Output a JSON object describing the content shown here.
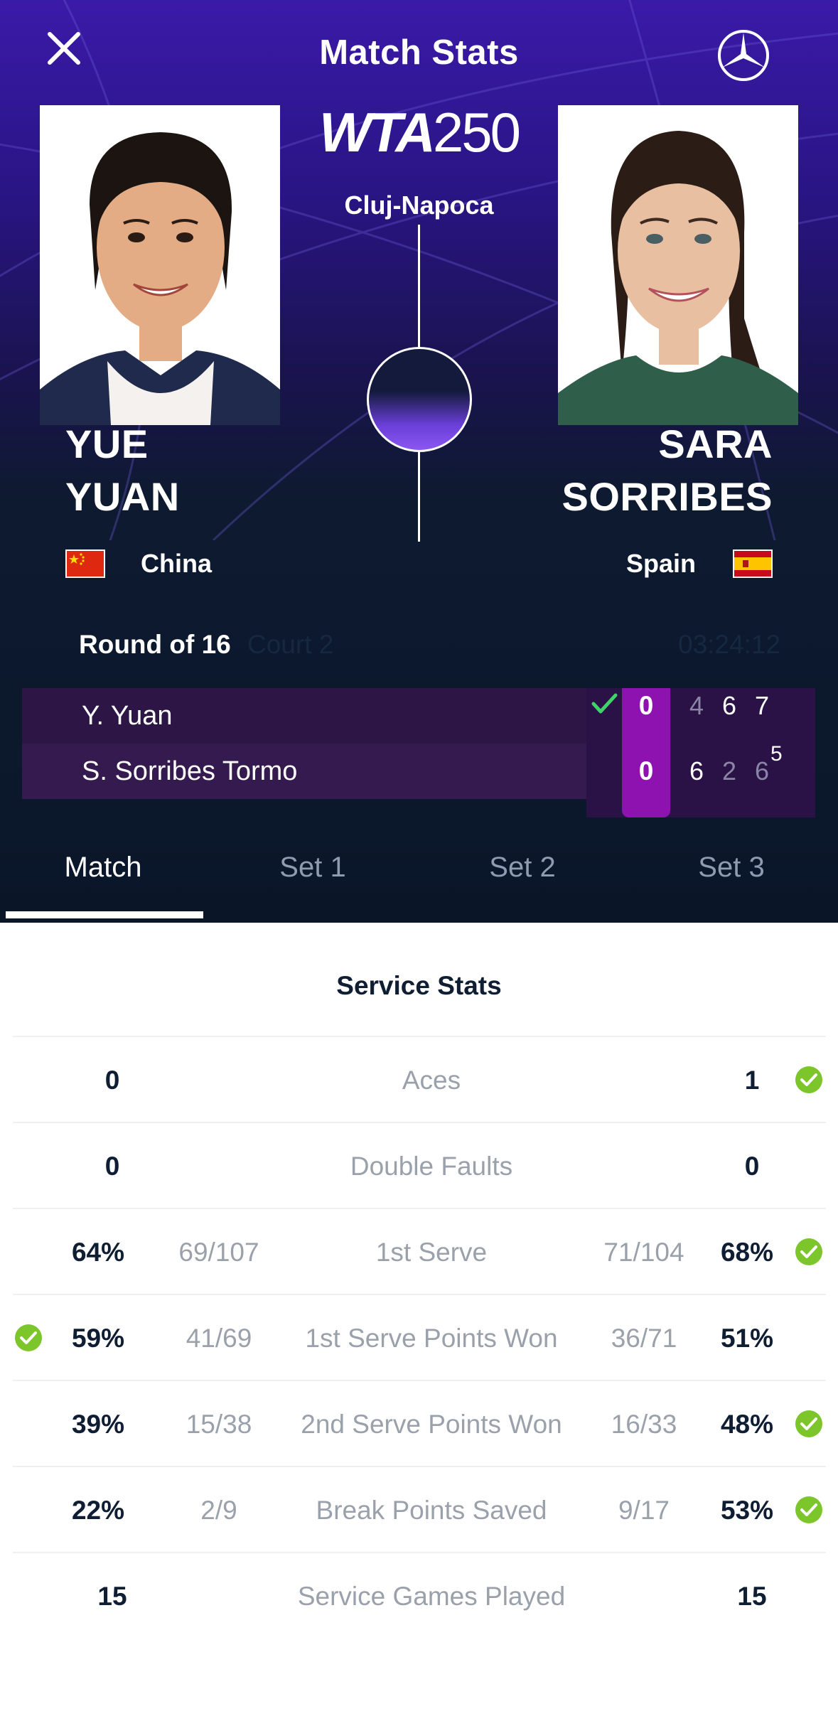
{
  "header": {
    "title": "Match Stats",
    "tournament_logo": "WTA",
    "tournament_level": "250",
    "venue": "Cluj-Napoca"
  },
  "players": {
    "left": {
      "first": "YUE",
      "last": "YUAN",
      "country": "China",
      "flag_icon": "china-flag-icon"
    },
    "right": {
      "first": "SARA",
      "last": "SORRIBES",
      "country": "Spain",
      "flag_icon": "spain-flag-icon"
    }
  },
  "match_info": {
    "round": "Round of 16",
    "court": "Court 2",
    "duration": "03:24:12"
  },
  "scoreboard": {
    "rows": [
      {
        "name": "Y. Yuan",
        "game": "0",
        "sets": [
          "4",
          "6",
          "7"
        ],
        "winner": true
      },
      {
        "name": "S. Sorribes Tormo",
        "game": "0",
        "sets": [
          "6",
          "2",
          "6"
        ],
        "tiebreak": "5",
        "winner": false
      }
    ]
  },
  "tabs": [
    "Match",
    "Set 1",
    "Set 2",
    "Set 3"
  ],
  "active_tab": "Match",
  "stats": {
    "section_title": "Service Stats",
    "rows": [
      {
        "label": "Aces",
        "left": "0",
        "right": "1",
        "left_frac": "",
        "right_frac": "",
        "leader": "right"
      },
      {
        "label": "Double Faults",
        "left": "0",
        "right": "0",
        "left_frac": "",
        "right_frac": "",
        "leader": ""
      },
      {
        "label": "1st Serve",
        "left": "64%",
        "right": "68%",
        "left_frac": "69/107",
        "right_frac": "71/104",
        "leader": "right"
      },
      {
        "label": "1st Serve Points Won",
        "left": "59%",
        "right": "51%",
        "left_frac": "41/69",
        "right_frac": "36/71",
        "leader": "left"
      },
      {
        "label": "2nd Serve Points Won",
        "left": "39%",
        "right": "48%",
        "left_frac": "15/38",
        "right_frac": "16/33",
        "leader": "right"
      },
      {
        "label": "Break Points Saved",
        "left": "22%",
        "right": "53%",
        "left_frac": "2/9",
        "right_frac": "9/17",
        "leader": "right"
      },
      {
        "label": "Service Games Played",
        "left": "15",
        "right": "15",
        "left_frac": "",
        "right_frac": "",
        "leader": ""
      }
    ]
  },
  "colors": {
    "accent_purple": "#8e12b0",
    "check_green": "#7cc62c",
    "header_dark": "#0a1628"
  }
}
